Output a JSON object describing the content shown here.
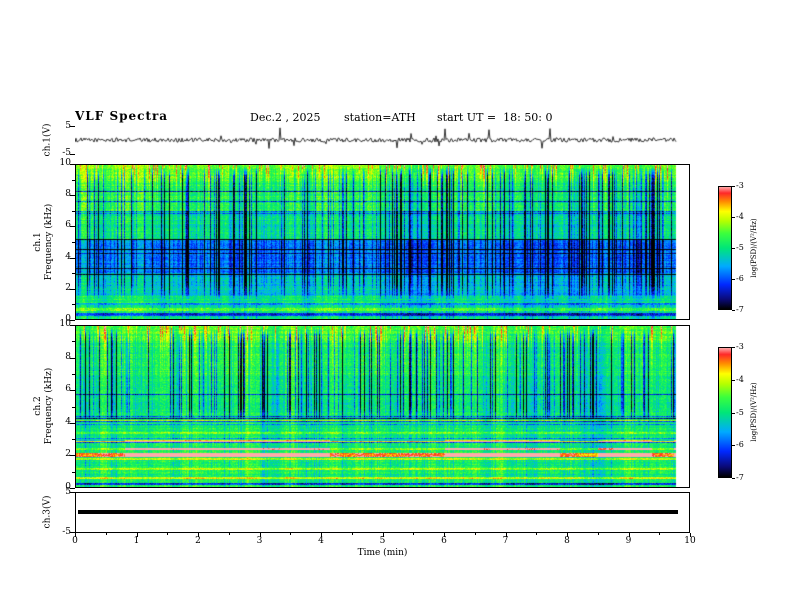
{
  "header": {
    "title": "VLF Spectra",
    "date": "Dec.2 , 2025",
    "station": "station=ATH",
    "start_ut": "start UT =  18: 50: 0"
  },
  "xaxis": {
    "label": "Time (min)",
    "ticks": [
      "0",
      "1",
      "2",
      "3",
      "4",
      "5",
      "6",
      "7",
      "8",
      "9",
      "10"
    ]
  },
  "panels": {
    "ch1_waveform": {
      "ylabel": "ch.1(V)",
      "yticks": [
        "5",
        "-5"
      ]
    },
    "ch1_spectrogram": {
      "ylabel_line1": "ch.1",
      "ylabel_line2": "Frequency (kHz)",
      "yticks": [
        "10",
        "8",
        "6",
        "4",
        "2",
        "0"
      ]
    },
    "ch2_spectrogram": {
      "ylabel_line1": "ch.2",
      "ylabel_line2": "Frequency (kHz)",
      "yticks": [
        "10",
        "8",
        "6",
        "4",
        "2",
        "0"
      ]
    },
    "ch3_waveform": {
      "ylabel": "ch.3(V)",
      "yticks": [
        "5",
        "-5"
      ]
    }
  },
  "colorbar": {
    "label": "log(PSD)/(V²/Hz)",
    "ticks": [
      "-3",
      "-4",
      "-5",
      "-6",
      "-7"
    ]
  },
  "chart_data": [
    {
      "type": "line",
      "name": "ch.1 waveform",
      "ylabel": "ch.1(V)",
      "x_units": "min",
      "xlim": [
        0,
        10
      ],
      "ylim": [
        -5,
        5
      ],
      "data_extent_min": [
        0,
        9.8
      ],
      "description": "Continuous noisy black trace centered on 0 V with fluctuations of roughly ±1 V and frequent impulsive spikes reaching about ±3 to ±5 V throughout the record."
    },
    {
      "type": "heatmap",
      "name": "ch.1 spectrogram",
      "xlabel": "Time (min)",
      "ylabel": "ch.1 Frequency (kHz)",
      "xlim": [
        0,
        10
      ],
      "ylim": [
        0,
        10
      ],
      "value_range": [
        -7,
        -3
      ],
      "colormap": "jet",
      "colorbar_label": "log(PSD)/(V²/Hz)",
      "colorbar_ticks": [
        -3,
        -4,
        -5,
        -6,
        -7
      ],
      "features": [
        "green/cyan background near -5 log(PSD)",
        "dense vertical dark-blue sferic streaks spanning roughly 1-10 kHz",
        "yellow-green enhanced intensity patches near 8-10 kHz",
        "darker blue quiet band around 3-5 kHz",
        "thin horizontal interference lines, strongest below about 1.3 kHz"
      ]
    },
    {
      "type": "heatmap",
      "name": "ch.2 spectrogram",
      "xlabel": "Time (min)",
      "ylabel": "ch.2 Frequency (kHz)",
      "xlim": [
        0,
        10
      ],
      "ylim": [
        0,
        10
      ],
      "value_range": [
        -7,
        -3
      ],
      "colormap": "jet",
      "colorbar_label": "log(PSD)/(V²/Hz)",
      "colorbar_ticks": [
        -3,
        -4,
        -5,
        -6,
        -7
      ],
      "features": [
        "upper half (≈4.5-10 kHz) similar to ch.1: green background with vertical dark-blue sferic streaks and yellow patches near the top",
        "lower half (0-4.5 kHz) dominated by horizontal power-line/hum harmonics",
        "strong broken red/dark-red line near 2 kHz (≈ -3.3 log(PSD))",
        "orange/yellow-green lines near 0.6, 1.1, 1.8, 2.4, 2.9, 3.4 kHz",
        "dark band at the very bottom near 0-0.3 kHz"
      ]
    },
    {
      "type": "line",
      "name": "ch.3 waveform",
      "ylabel": "ch.3(V)",
      "xlim": [
        0,
        10
      ],
      "ylim": [
        -5,
        5
      ],
      "values_summary": "constant 0",
      "description": "Flat thick black line at 0 V for the whole interval (no signal on channel 3)."
    }
  ]
}
